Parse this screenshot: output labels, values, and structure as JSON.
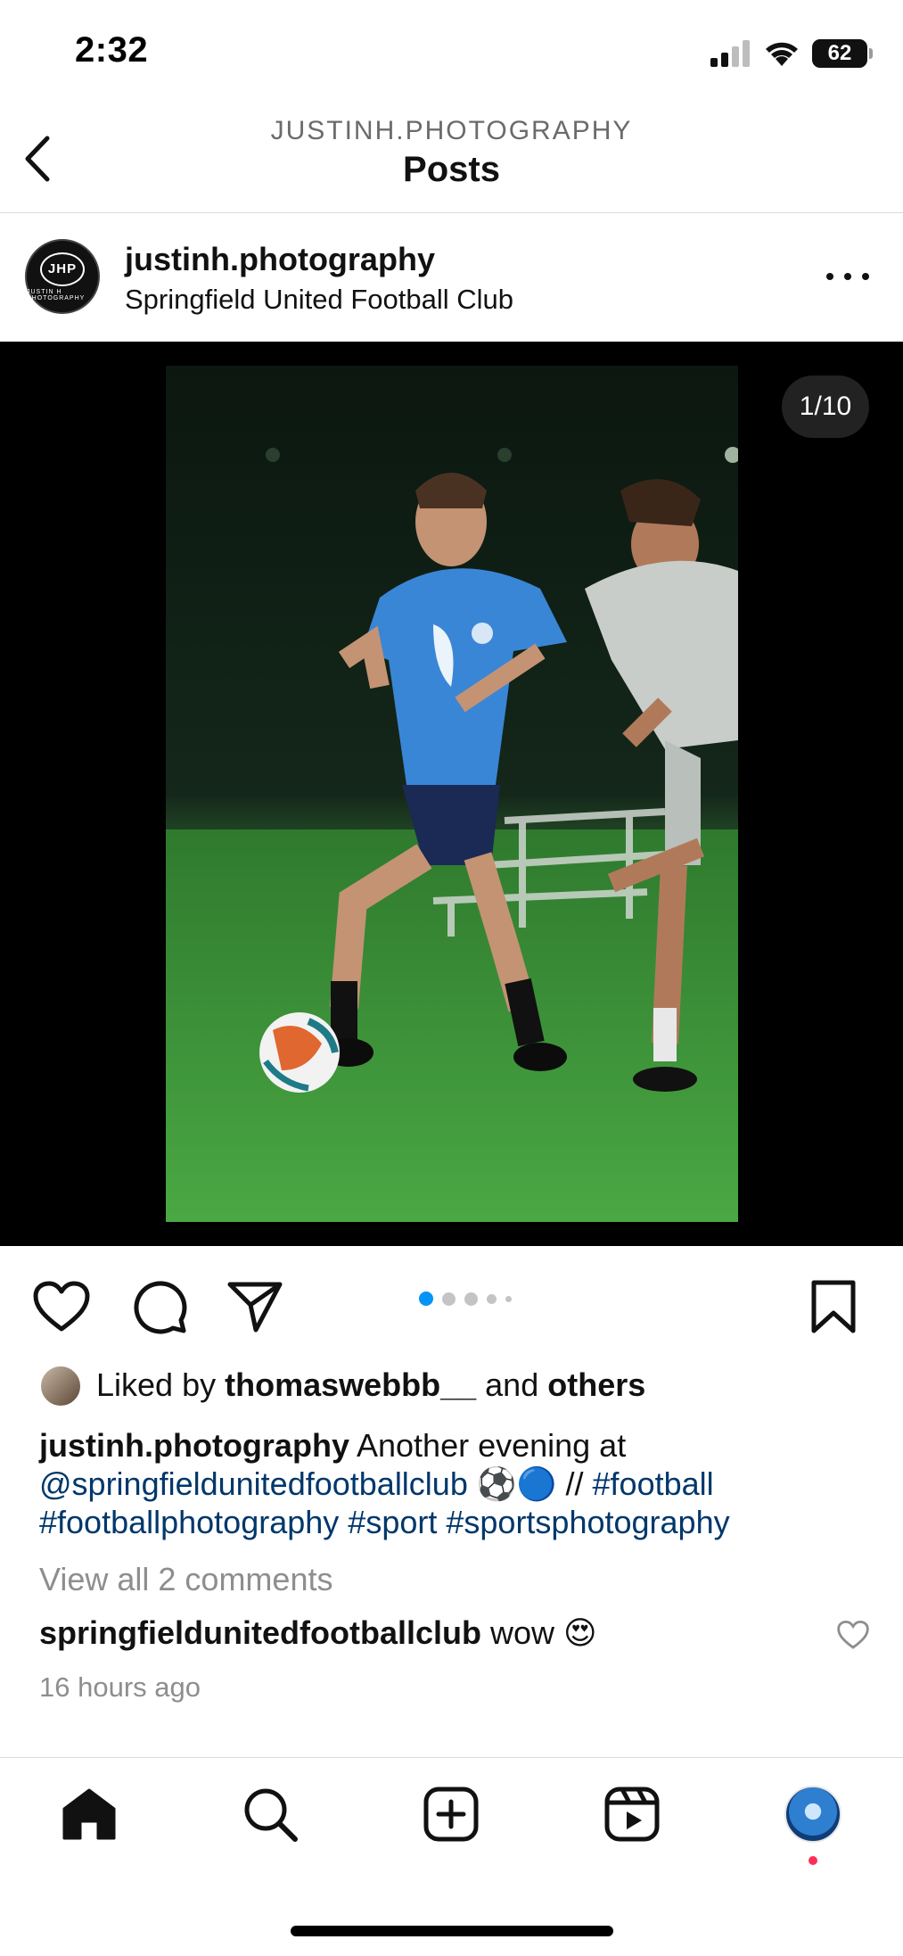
{
  "status_bar": {
    "time": "2:32",
    "battery_level": "62",
    "icons": [
      "signal-icon",
      "wifi-icon",
      "battery-icon"
    ]
  },
  "header": {
    "subtitle": "JUSTINH.PHOTOGRAPHY",
    "title": "Posts",
    "back_icon": "chevron-left-icon"
  },
  "post": {
    "username": "justinh.photography",
    "location": "Springfield United Football Club",
    "avatar_icon": "jhp-logo",
    "avatar_text": "JHP",
    "avatar_subtext": "JUSTIN H PHOTOGRAPHY",
    "media_counter": "1/10",
    "carousel": {
      "count": 5,
      "active_index": 0,
      "active_color": "#0095f6"
    },
    "likes": {
      "prefix": "Liked by ",
      "user": "thomaswebbb__",
      "middle": " and ",
      "others": "others"
    },
    "caption": {
      "username": "justinh.photography",
      "text1": " Another evening at",
      "mention": "@springfieldunitedfootballclub",
      "emojis": " ⚽🔵 // ",
      "tag_football": "#football",
      "tag_footballphotography": "#footballphotography",
      "tag_sport": "#sport",
      "tag_sportsphotography": "#sportsphotography"
    },
    "view_comments": "View all 2 comments",
    "comment": {
      "username": "springfieldunitedfootballclub",
      "text": " wow 😍"
    },
    "time_ago": "16 hours ago"
  },
  "actions": [
    "heart-icon",
    "comment-icon",
    "share-icon",
    "bookmark-icon"
  ],
  "tab_bar": [
    "home-icon",
    "search-icon",
    "create-icon",
    "reels-icon",
    "profile-avatar"
  ],
  "colors": {
    "link": "#00376b",
    "muted": "#8e8e8e",
    "accent": "#0095f6",
    "pitch": "#3f9a3a",
    "kit_blue": "#3a86d6"
  }
}
